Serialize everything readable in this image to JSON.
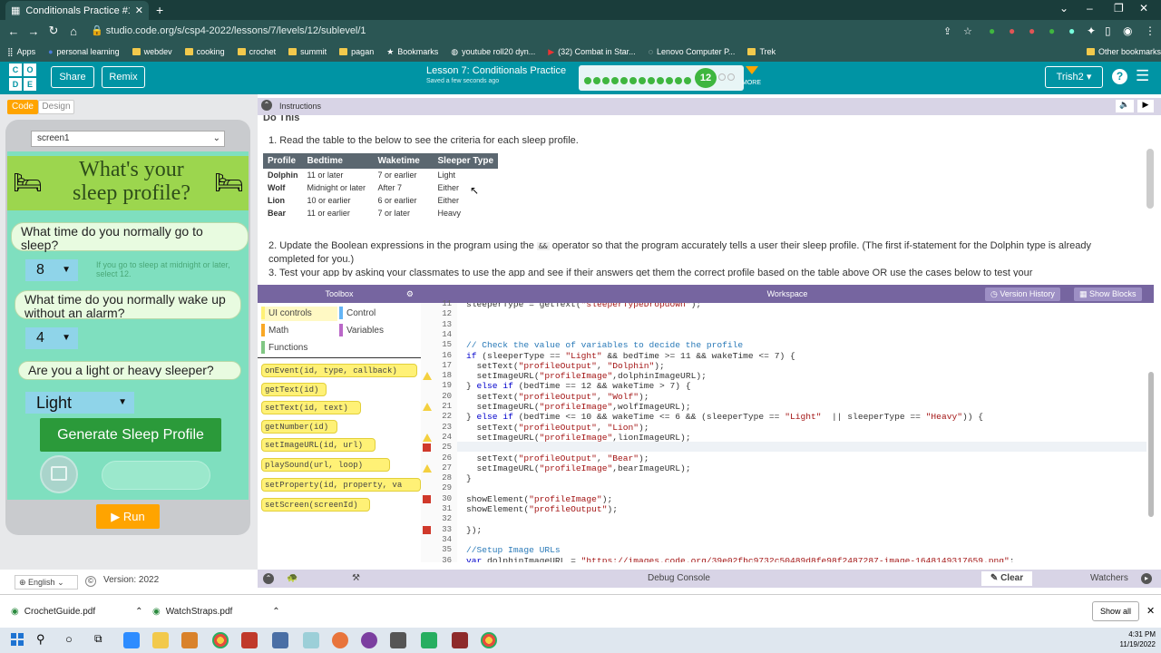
{
  "browser": {
    "tab_title": "Conditionals Practice #12 | Varia",
    "url": "studio.code.org/s/csp4-2022/lessons/7/levels/12/sublevel/1",
    "bookmarks": [
      "Apps",
      "personal learning",
      "webdev",
      "cooking",
      "crochet",
      "summit",
      "pagan",
      "Bookmarks",
      "youtube roll20 dyn...",
      "(32) Combat in Star...",
      "Lenovo Computer P...",
      "Trek"
    ],
    "other_bookmarks": "Other bookmarks"
  },
  "app": {
    "share": "Share",
    "remix": "Remix",
    "lesson_title": "Lesson 7: Conditionals Practice",
    "saved": "Saved a few seconds ago",
    "level": "12",
    "more": "MORE",
    "user": "Trish2"
  },
  "left": {
    "tab_code": "Code",
    "tab_design": "Design",
    "screen": "screen1",
    "title": "What's your sleep profile?",
    "q1": "What time do you normally go to sleep?",
    "bed_value": "8",
    "hint": "If you go to sleep at midnight or later, select 12.",
    "q2": "What time do you normally wake up without an alarm?",
    "wake_value": "4",
    "q3": "Are you a light or heavy sleeper?",
    "sleeper_value": "Light",
    "generate": "Generate Sleep Profile",
    "run": "Run",
    "language": "English",
    "version": "Version: 2022"
  },
  "instructions": {
    "header": "Instructions",
    "cut_heading": "Do This",
    "step1": "1. Read the table to the below to see the criteria for each sleep profile.",
    "table_headers": [
      "Profile",
      "Bedtime",
      "Waketime",
      "Sleeper Type"
    ],
    "table_rows": [
      [
        "Dolphin",
        "11 or later",
        "7 or earlier",
        "Light"
      ],
      [
        "Wolf",
        "Midnight or later",
        "After 7",
        "Either"
      ],
      [
        "Lion",
        "10 or earlier",
        "6 or earlier",
        "Either"
      ],
      [
        "Bear",
        "11 or earlier",
        "7 or later",
        "Heavy"
      ]
    ],
    "step2a": "2. Update the Boolean expressions in the program using the",
    "step2op": "&&",
    "step2b": "operator so that the program accurately tells a user their sleep profile. (The first if-statement for the Dolphin type is already completed for you.)",
    "step3": "3. Test your app by asking your classmates to use the app and see if their answers get them the correct profile based on the table above OR use the cases below to test your"
  },
  "toolbox": {
    "title": "Toolbox",
    "categories": [
      "UI controls",
      "Control",
      "Math",
      "Variables",
      "Functions"
    ],
    "blocks": [
      "onEvent(id, type, callback)",
      "getText(id)",
      "setText(id, text)",
      "getNumber(id)",
      "setImageURL(id, url)",
      "playSound(url, loop)",
      "setProperty(id, property, va",
      "setScreen(screenId)"
    ]
  },
  "workspace": {
    "title": "Workspace",
    "version_history": "Version History",
    "show_blocks": "Show Blocks",
    "line_numbers": [
      "11",
      "12",
      "13",
      "14",
      "15",
      "16",
      "17",
      "18",
      "19",
      "20",
      "21",
      "22",
      "23",
      "24",
      "25",
      "26",
      "27",
      "28",
      "29",
      "30",
      "31",
      "32",
      "33",
      "34",
      "35",
      "36"
    ],
    "code_lines": [
      "sleeperType = getText(\"sleeperTypeDropdown\");",
      "",
      "",
      "",
      "// Check the value of variables to decide the profile",
      "if (sleeperType == \"Light\" && bedTime >= 11 && wakeTime <= 7) {",
      "  setText(\"profileOutput\", \"Dolphin\");",
      "  setImageURL(\"profileImage\",dolphinImageURL);",
      "} else if (bedTime == 12 && wakeTime > 7) {",
      "  setText(\"profileOutput\", \"Wolf\");",
      "  setImageURL(\"profileImage\",wolfImageURL);",
      "} else if (bedTime <= 10 && wakeTime <= 6 && (sleeperType == \"Light\"  || sleeperType == \"Heavy\")) {",
      "  setText(\"profileOutput\", \"Lion\");",
      "  setImageURL(\"profileImage\",lionImageURL);",
      "} else if(bedTime < 12 && |{",
      "  setText(\"profileOutput\", \"Bear\");",
      "  setImageURL(\"profileImage\",bearImageURL);",
      "}",
      "",
      "showElement(\"profileImage\");",
      "showElement(\"profileOutput\");",
      "",
      "});",
      "",
      "//Setup Image URLs",
      "var dolphinImageURL = \"https://images.code.org/39e02fbc9732c50489d8fe98f2487287-image-1648149317659.png\";"
    ]
  },
  "debug": {
    "title": "Debug Console",
    "clear": "Clear",
    "watchers": "Watchers"
  },
  "downloads": {
    "items": [
      "CrochetGuide.pdf",
      "WatchStraps.pdf"
    ],
    "show_all": "Show all"
  },
  "taskbar": {
    "time": "4:31 PM",
    "date": "11/19/2022"
  },
  "colors": {
    "teal": "#0094a4",
    "purple": "#7665a0",
    "green": "#3fb63f",
    "orange": "#ffa400"
  }
}
